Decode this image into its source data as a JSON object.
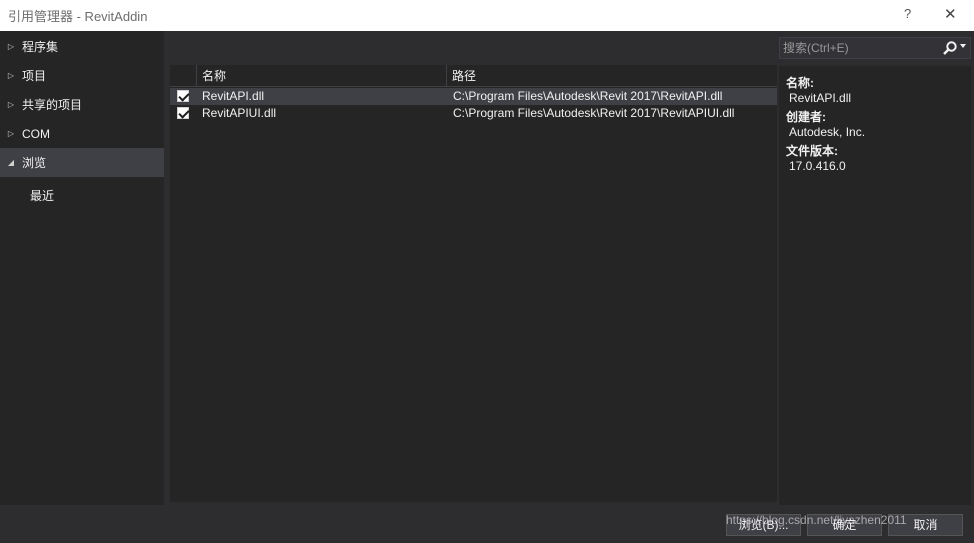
{
  "window": {
    "title": "引用管理器 - RevitAddin",
    "help_label": "?",
    "close_label": "✕"
  },
  "sidebar": {
    "items": [
      {
        "label": "程序集",
        "arrow": "▷"
      },
      {
        "label": "项目",
        "arrow": "▷"
      },
      {
        "label": "共享的项目",
        "arrow": "▷"
      },
      {
        "label": "COM",
        "arrow": "▷"
      },
      {
        "label": "浏览",
        "arrow": "◢"
      }
    ],
    "subitem": "最近"
  },
  "list": {
    "columns": [
      "名称",
      "路径"
    ],
    "rows": [
      {
        "name": "RevitAPI.dll",
        "path": "C:\\Program Files\\Autodesk\\Revit 2017\\RevitAPI.dll",
        "checked": true
      },
      {
        "name": "RevitAPIUI.dll",
        "path": "C:\\Program Files\\Autodesk\\Revit 2017\\RevitAPIUI.dll",
        "checked": true
      }
    ]
  },
  "search": {
    "placeholder": "搜索(Ctrl+E)"
  },
  "details": {
    "name_label": "名称:",
    "name_value": "RevitAPI.dll",
    "author_label": "创建者:",
    "author_value": "Autodesk, Inc.",
    "version_label": "文件版本:",
    "version_value": "17.0.416.0"
  },
  "footer": {
    "browse_label": "浏览(B)...",
    "ok_label": "确定",
    "cancel_label": "取消"
  },
  "watermark": "https://blog.csdn.net/liyazhen2011",
  "colors": {
    "background": "#2d2d30",
    "panel": "#252526",
    "selection": "#3f3f46",
    "text": "#f1f1f1"
  }
}
